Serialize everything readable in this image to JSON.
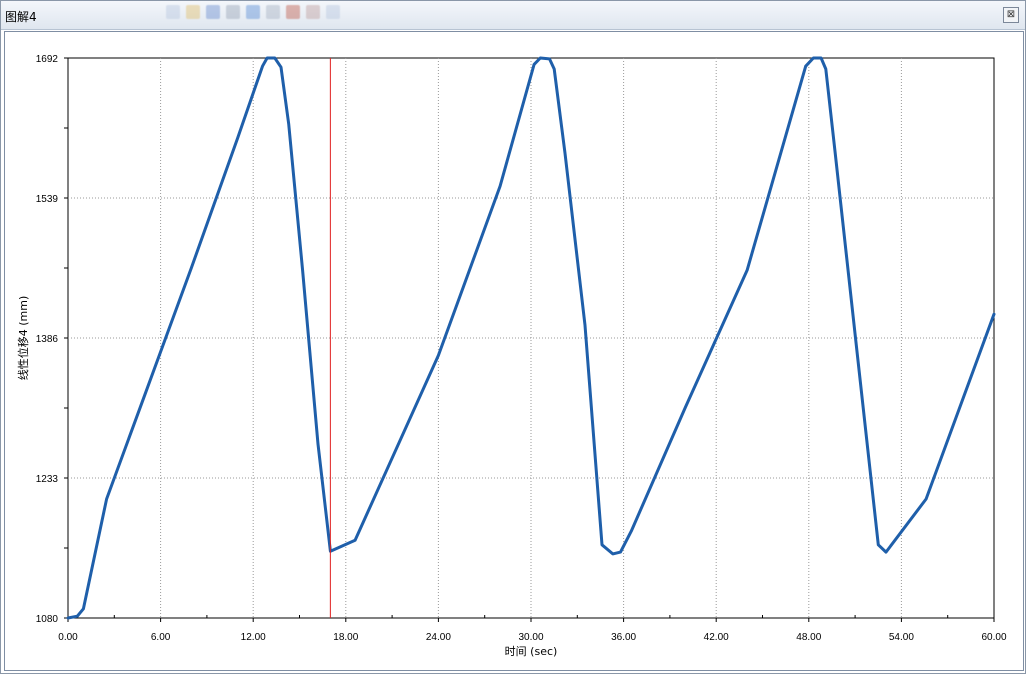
{
  "window": {
    "title": "图解4",
    "close_glyph": "⊠"
  },
  "chart_data": {
    "type": "line",
    "title": "",
    "xlabel": "时间 (sec)",
    "ylabel": "线性位移4 (mm)",
    "xlim": [
      0,
      60
    ],
    "ylim": [
      1080,
      1692
    ],
    "x_ticks": [
      "0.00",
      "6.00",
      "12.00",
      "18.00",
      "24.00",
      "30.00",
      "36.00",
      "42.00",
      "48.00",
      "54.00",
      "60.00"
    ],
    "y_ticks": [
      "1080",
      "1233",
      "1386",
      "1539",
      "1692"
    ],
    "grid": true,
    "legend": "none",
    "cursor_x": 17.0,
    "colors": {
      "series": "#1f5faa",
      "cursor": "#e02020",
      "grid": "#9a9a9a"
    },
    "series": [
      {
        "x": [
          0.0,
          0.6,
          1.0,
          2.5,
          5.0,
          8.0,
          11.0,
          12.6,
          12.9,
          13.4,
          13.8,
          14.3,
          15.2,
          16.2,
          17.0,
          18.6,
          24.0,
          28.0,
          30.2,
          30.6,
          31.2,
          31.5,
          32.2,
          33.5,
          34.6,
          35.3,
          35.8,
          36.5,
          40.0,
          44.0,
          47.8,
          48.3,
          48.8,
          49.1,
          49.7,
          51.0,
          52.5,
          53.0,
          55.6,
          60.0
        ],
        "y": [
          1080,
          1082,
          1090,
          1210,
          1325,
          1463,
          1605,
          1683,
          1692,
          1692,
          1682,
          1620,
          1460,
          1270,
          1153,
          1165,
          1367,
          1552,
          1685,
          1692,
          1691,
          1680,
          1588,
          1400,
          1160,
          1150,
          1152,
          1175,
          1310,
          1460,
          1683,
          1692,
          1692,
          1680,
          1590,
          1390,
          1160,
          1152,
          1210,
          1412
        ]
      }
    ]
  }
}
